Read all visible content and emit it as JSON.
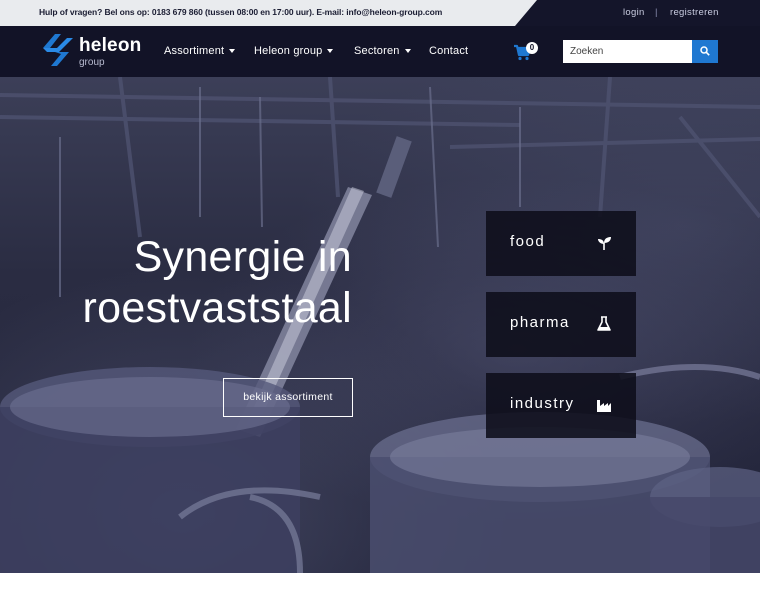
{
  "topbar": {
    "help_text": "Hulp of vragen? Bel ons op: 0183 679 860 (tussen 08:00 en 17:00 uur). E-mail: info@heleon-group.com",
    "login": "login",
    "separator": "|",
    "register": "registreren"
  },
  "logo": {
    "name": "heleon",
    "sub": "group"
  },
  "nav": {
    "items": [
      {
        "label": "Assortiment",
        "dropdown": true
      },
      {
        "label": "Heleon group",
        "dropdown": true
      },
      {
        "label": "Sectoren",
        "dropdown": true
      },
      {
        "label": "Contact",
        "dropdown": false
      }
    ]
  },
  "cart": {
    "count": "0",
    "icon": "cart-icon"
  },
  "search": {
    "placeholder": "Zoeken",
    "icon": "search-icon"
  },
  "hero": {
    "title_line1": "Synergie in",
    "title_line2": "roestvaststaal",
    "button": "bekijk assortiment"
  },
  "sectors": [
    {
      "label": "food",
      "icon": "sprout-icon"
    },
    {
      "label": "pharma",
      "icon": "flask-icon"
    },
    {
      "label": "industry",
      "icon": "factory-icon"
    }
  ],
  "colors": {
    "nav_bg": "#121327",
    "accent_blue": "#1f78d1",
    "topbar_bg": "#e9ebee"
  }
}
